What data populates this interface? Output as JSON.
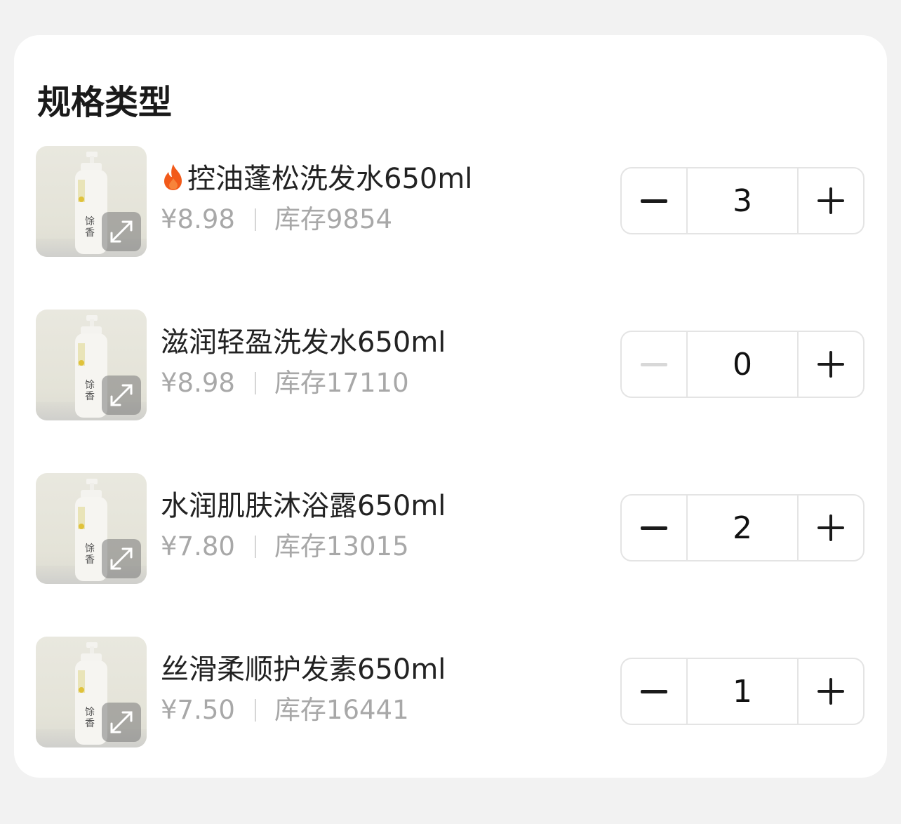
{
  "section": {
    "title": "规格类型"
  },
  "colors": {
    "accent_flame": "#f25a1a",
    "price_gray": "#a8a8a8"
  },
  "items": [
    {
      "hot": true,
      "hot_icon": "flame-icon",
      "name": "控油蓬松洗发水650ml",
      "price": "¥8.98",
      "stock": "库存9854",
      "quantity": "3",
      "minus_enabled": true
    },
    {
      "hot": false,
      "name": "滋润轻盈洗发水650ml",
      "price": "¥8.98",
      "stock": "库存17110",
      "quantity": "0",
      "minus_enabled": false
    },
    {
      "hot": false,
      "name": "水润肌肤沐浴露650ml",
      "price": "¥7.80",
      "stock": "库存13015",
      "quantity": "2",
      "minus_enabled": true
    },
    {
      "hot": false,
      "name": "丝滑柔顺护发素650ml",
      "price": "¥7.50",
      "stock": "库存16441",
      "quantity": "1",
      "minus_enabled": true
    }
  ]
}
